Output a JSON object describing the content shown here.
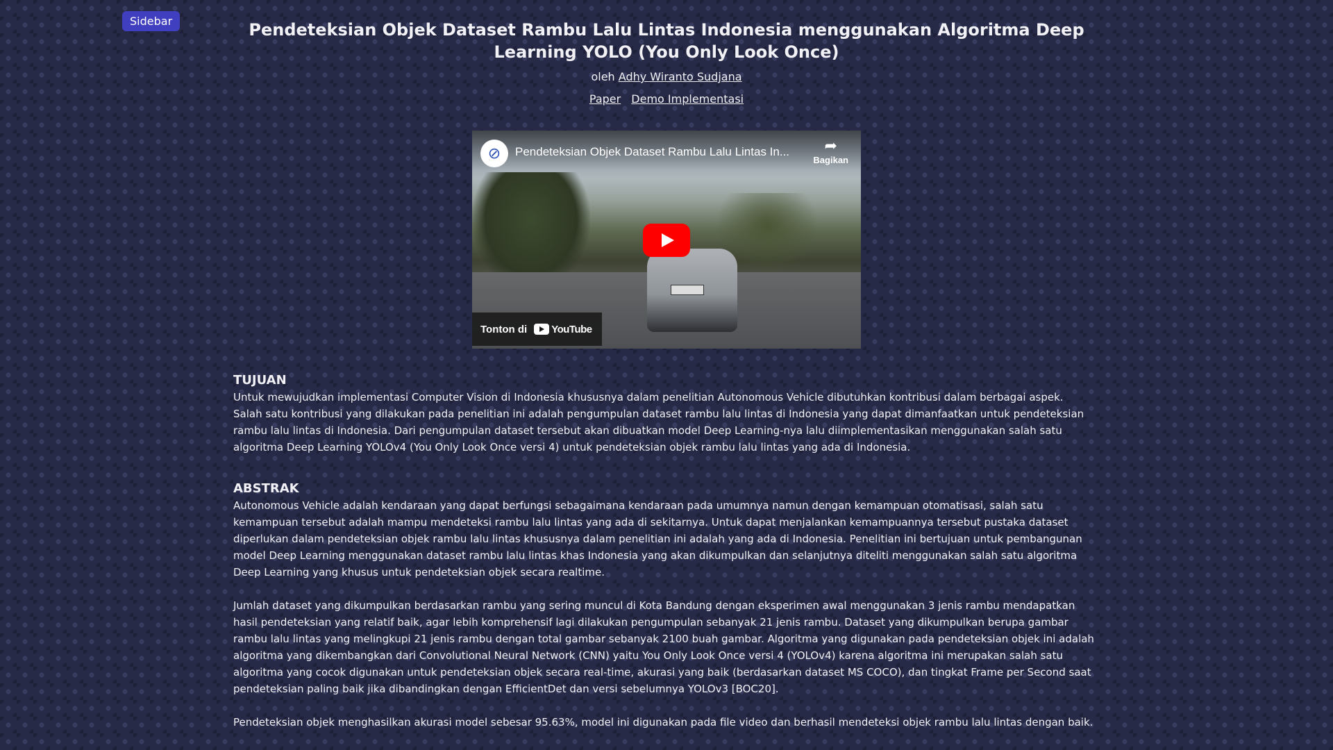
{
  "sidebar_button": "Sidebar",
  "title": "Pendeteksian Objek Dataset Rambu Lalu Lintas Indonesia menggunakan Algoritma Deep Learning YOLO (You Only Look Once)",
  "byline": {
    "prefix": "oleh",
    "author": "Adhy Wiranto Sudjana"
  },
  "links": {
    "paper": "Paper",
    "demo": "Demo Implementasi"
  },
  "video": {
    "title": "Pendeteksian Objek Dataset Rambu Lalu Lintas In...",
    "share_label": "Bagikan",
    "watch_on": "Tonton di",
    "platform": "YouTube",
    "play_color": "#ff0000"
  },
  "tujuan": {
    "heading": "TUJUAN",
    "body": "Untuk mewujudkan implementasi Computer Vision di Indonesia khususnya dalam penelitian Autonomous Vehicle dibutuhkan kontribusi dalam berbagai aspek. Salah satu kontribusi yang dilakukan pada penelitian ini adalah pengumpulan dataset rambu lalu lintas di Indonesia yang dapat dimanfaatkan untuk pendeteksian rambu lalu lintas di Indonesia. Dari pengumpulan dataset tersebut akan dibuatkan model Deep Learning-nya lalu diimplementasikan menggunakan salah satu algoritma Deep Learning YOLOv4 (You Only Look Once versi 4) untuk pendeteksian objek rambu lalu lintas yang ada di Indonesia."
  },
  "abstrak": {
    "heading": "ABSTRAK",
    "p1": "Autonomous Vehicle adalah kendaraan yang dapat berfungsi sebagaimana kendaraan pada umumnya namun dengan kemampuan otomatisasi, salah satu kemampuan tersebut adalah mampu mendeteksi rambu lalu lintas yang ada di sekitarnya. Untuk dapat menjalankan kemampuannya tersebut pustaka dataset diperlukan dalam pendeteksian objek rambu lalu lintas khususnya dalam penelitian ini adalah yang ada di Indonesia. Penelitian ini bertujuan untuk pembangunan model Deep Learning menggunakan dataset rambu lalu lintas khas Indonesia yang akan dikumpulkan dan selanjutnya diteliti menggunakan salah satu algoritma Deep Learning yang khusus untuk pendeteksian objek secara realtime.",
    "p2": "Jumlah dataset yang dikumpulkan berdasarkan rambu yang sering muncul di Kota Bandung dengan eksperimen awal menggunakan 3 jenis rambu mendapatkan hasil pendeteksian yang relatif baik, agar lebih komprehensif lagi dilakukan pengumpulan sebanyak 21 jenis rambu. Dataset yang dikumpulkan berupa gambar rambu lalu lintas yang melingkupi 21 jenis rambu dengan total gambar sebanyak 2100 buah gambar. Algoritma yang digunakan pada pendeteksian objek ini adalah algoritma yang dikembangkan dari Convolutional Neural Network (CNN) yaitu You Only Look Once versi 4 (YOLOv4) karena algoritma ini merupakan salah satu algoritma yang cocok digunakan untuk pendeteksian objek secara real-time, akurasi yang baik (berdasarkan dataset MS COCO), dan tingkat Frame per Second saat pendeteksian paling baik jika dibandingkan dengan EfficientDet dan versi sebelumnya YOLOv3 [BOC20].",
    "p3": "Pendeteksian objek menghasilkan akurasi model sebesar 95.63%, model ini digunakan pada file video dan berhasil mendeteksi objek rambu lalu lintas dengan baik."
  }
}
